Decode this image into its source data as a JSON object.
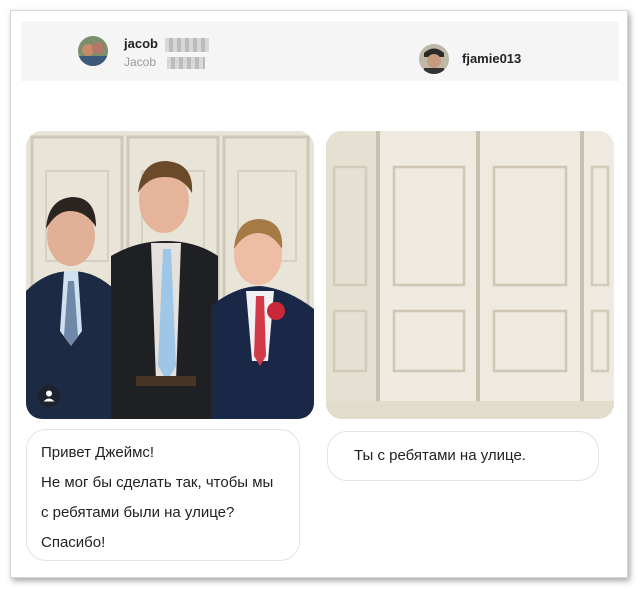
{
  "left_user": {
    "username": "jacob",
    "subtitle": "Jacob"
  },
  "right_user": {
    "username": "fjamie013"
  },
  "left_message": {
    "lines": [
      "Привет Джеймс!",
      "Не мог бы сделать так, чтобы мы",
      "с ребятами были на улице?",
      "Спасибо!"
    ]
  },
  "right_message": {
    "text": "Ты с ребятами на улице."
  },
  "icons": {
    "left_photo_overlay": "user-icon"
  }
}
